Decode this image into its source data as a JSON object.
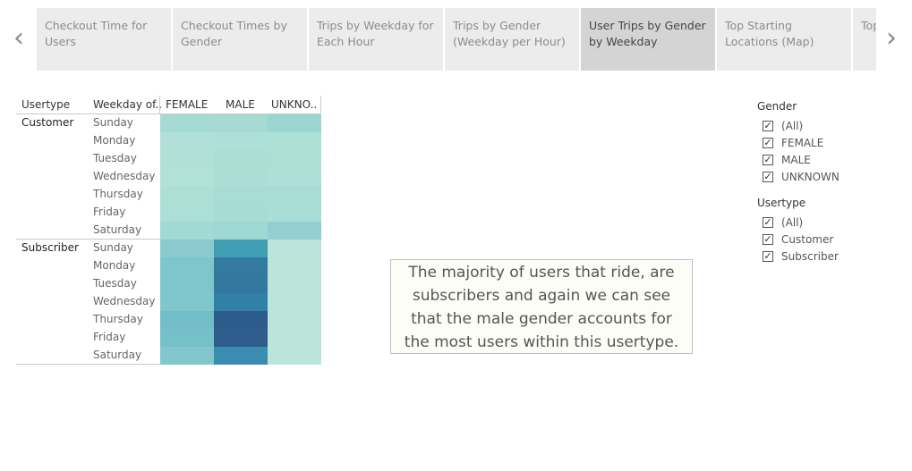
{
  "nav": {
    "prev_glyph": "‹",
    "next_glyph": "›"
  },
  "tabs": [
    {
      "label": "Checkout Time for Users"
    },
    {
      "label": "Checkout Times by Gender"
    },
    {
      "label": "Trips by Weekday for Each Hour"
    },
    {
      "label": "Trips by Gender (Weekday per Hour)"
    },
    {
      "label": "User Trips by Gender by Weekday",
      "active": true
    },
    {
      "label": "Top Starting Locations (Map)"
    },
    {
      "label": "Top (M"
    }
  ],
  "table": {
    "headers": {
      "usertype": "Usertype",
      "weekday": "Weekday of..",
      "female": "FEMALE",
      "male": "MALE",
      "unknown": "UNKNO.."
    },
    "groups": [
      {
        "usertype": "Customer",
        "days": [
          "Sunday",
          "Monday",
          "Tuesday",
          "Wednesday",
          "Thursday",
          "Friday",
          "Saturday"
        ],
        "colors": [
          [
            "#a6dbd3",
            "#a6dad3",
            "#9cd5d1"
          ],
          [
            "#b0e0d7",
            "#ade0d6",
            "#ade0d6"
          ],
          [
            "#b0e0d7",
            "#abdfd6",
            "#addfd7"
          ],
          [
            "#b2e1d7",
            "#acded5",
            "#afe0d7"
          ],
          [
            "#acdfd6",
            "#a8ddd6",
            "#a8ddd6"
          ],
          [
            "#acdfd6",
            "#a7dcd5",
            "#a9ddd5"
          ],
          [
            "#a3d9d4",
            "#9fd7d3",
            "#93cfd1"
          ]
        ]
      },
      {
        "usertype": "Subscriber",
        "days": [
          "Sunday",
          "Monday",
          "Tuesday",
          "Wednesday",
          "Thursday",
          "Friday",
          "Saturday"
        ],
        "colors": [
          [
            "#8bcbcf",
            "#3f9eb4",
            "#bbe5d8"
          ],
          [
            "#7fc5cc",
            "#34799f",
            "#bce5d9"
          ],
          [
            "#7fc5cc",
            "#32789f",
            "#bce5d9"
          ],
          [
            "#80c6cd",
            "#3180a7",
            "#bce5d9"
          ],
          [
            "#73bdc8",
            "#2d5c8c",
            "#bce5d9"
          ],
          [
            "#76c0ca",
            "#2e5d8d",
            "#bce5d9"
          ],
          [
            "#82c7cd",
            "#3a8db1",
            "#bce5d9"
          ]
        ]
      }
    ]
  },
  "annotation": {
    "lines": [
      "The majority of users that ride, are",
      "subscribers and again we can see",
      "that the male gender accounts for",
      "the most users within this usertype."
    ]
  },
  "filters": {
    "gender": {
      "title": "Gender",
      "items": [
        "(All)",
        "FEMALE",
        "MALE",
        "UNKNOWN"
      ]
    },
    "usertype": {
      "title": "Usertype",
      "items": [
        "(All)",
        "Customer",
        "Subscriber"
      ]
    },
    "check_glyph": "✓"
  }
}
